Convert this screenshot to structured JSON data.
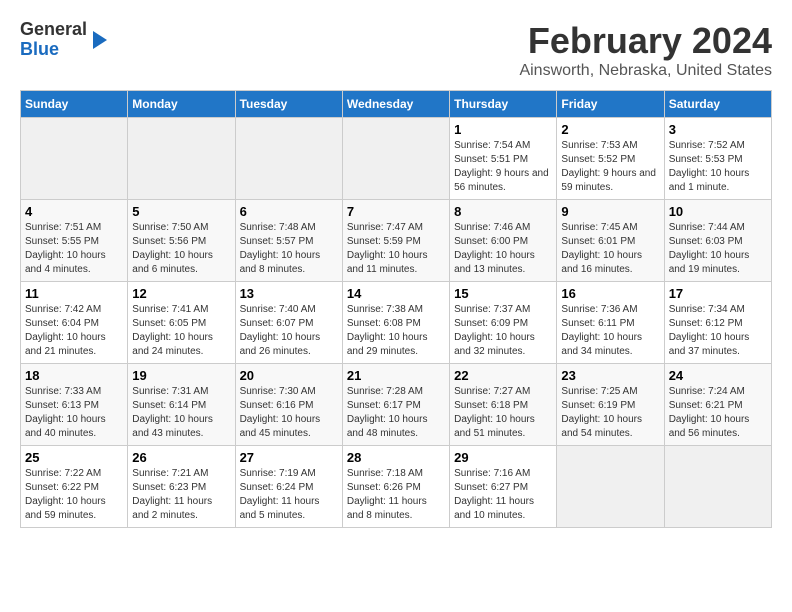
{
  "header": {
    "logo_line1": "General",
    "logo_line2": "Blue",
    "month": "February 2024",
    "location": "Ainsworth, Nebraska, United States"
  },
  "weekdays": [
    "Sunday",
    "Monday",
    "Tuesday",
    "Wednesday",
    "Thursday",
    "Friday",
    "Saturday"
  ],
  "weeks": [
    [
      {
        "day": "",
        "info": ""
      },
      {
        "day": "",
        "info": ""
      },
      {
        "day": "",
        "info": ""
      },
      {
        "day": "",
        "info": ""
      },
      {
        "day": "1",
        "info": "Sunrise: 7:54 AM\nSunset: 5:51 PM\nDaylight: 9 hours and 56 minutes."
      },
      {
        "day": "2",
        "info": "Sunrise: 7:53 AM\nSunset: 5:52 PM\nDaylight: 9 hours and 59 minutes."
      },
      {
        "day": "3",
        "info": "Sunrise: 7:52 AM\nSunset: 5:53 PM\nDaylight: 10 hours and 1 minute."
      }
    ],
    [
      {
        "day": "4",
        "info": "Sunrise: 7:51 AM\nSunset: 5:55 PM\nDaylight: 10 hours and 4 minutes."
      },
      {
        "day": "5",
        "info": "Sunrise: 7:50 AM\nSunset: 5:56 PM\nDaylight: 10 hours and 6 minutes."
      },
      {
        "day": "6",
        "info": "Sunrise: 7:48 AM\nSunset: 5:57 PM\nDaylight: 10 hours and 8 minutes."
      },
      {
        "day": "7",
        "info": "Sunrise: 7:47 AM\nSunset: 5:59 PM\nDaylight: 10 hours and 11 minutes."
      },
      {
        "day": "8",
        "info": "Sunrise: 7:46 AM\nSunset: 6:00 PM\nDaylight: 10 hours and 13 minutes."
      },
      {
        "day": "9",
        "info": "Sunrise: 7:45 AM\nSunset: 6:01 PM\nDaylight: 10 hours and 16 minutes."
      },
      {
        "day": "10",
        "info": "Sunrise: 7:44 AM\nSunset: 6:03 PM\nDaylight: 10 hours and 19 minutes."
      }
    ],
    [
      {
        "day": "11",
        "info": "Sunrise: 7:42 AM\nSunset: 6:04 PM\nDaylight: 10 hours and 21 minutes."
      },
      {
        "day": "12",
        "info": "Sunrise: 7:41 AM\nSunset: 6:05 PM\nDaylight: 10 hours and 24 minutes."
      },
      {
        "day": "13",
        "info": "Sunrise: 7:40 AM\nSunset: 6:07 PM\nDaylight: 10 hours and 26 minutes."
      },
      {
        "day": "14",
        "info": "Sunrise: 7:38 AM\nSunset: 6:08 PM\nDaylight: 10 hours and 29 minutes."
      },
      {
        "day": "15",
        "info": "Sunrise: 7:37 AM\nSunset: 6:09 PM\nDaylight: 10 hours and 32 minutes."
      },
      {
        "day": "16",
        "info": "Sunrise: 7:36 AM\nSunset: 6:11 PM\nDaylight: 10 hours and 34 minutes."
      },
      {
        "day": "17",
        "info": "Sunrise: 7:34 AM\nSunset: 6:12 PM\nDaylight: 10 hours and 37 minutes."
      }
    ],
    [
      {
        "day": "18",
        "info": "Sunrise: 7:33 AM\nSunset: 6:13 PM\nDaylight: 10 hours and 40 minutes."
      },
      {
        "day": "19",
        "info": "Sunrise: 7:31 AM\nSunset: 6:14 PM\nDaylight: 10 hours and 43 minutes."
      },
      {
        "day": "20",
        "info": "Sunrise: 7:30 AM\nSunset: 6:16 PM\nDaylight: 10 hours and 45 minutes."
      },
      {
        "day": "21",
        "info": "Sunrise: 7:28 AM\nSunset: 6:17 PM\nDaylight: 10 hours and 48 minutes."
      },
      {
        "day": "22",
        "info": "Sunrise: 7:27 AM\nSunset: 6:18 PM\nDaylight: 10 hours and 51 minutes."
      },
      {
        "day": "23",
        "info": "Sunrise: 7:25 AM\nSunset: 6:19 PM\nDaylight: 10 hours and 54 minutes."
      },
      {
        "day": "24",
        "info": "Sunrise: 7:24 AM\nSunset: 6:21 PM\nDaylight: 10 hours and 56 minutes."
      }
    ],
    [
      {
        "day": "25",
        "info": "Sunrise: 7:22 AM\nSunset: 6:22 PM\nDaylight: 10 hours and 59 minutes."
      },
      {
        "day": "26",
        "info": "Sunrise: 7:21 AM\nSunset: 6:23 PM\nDaylight: 11 hours and 2 minutes."
      },
      {
        "day": "27",
        "info": "Sunrise: 7:19 AM\nSunset: 6:24 PM\nDaylight: 11 hours and 5 minutes."
      },
      {
        "day": "28",
        "info": "Sunrise: 7:18 AM\nSunset: 6:26 PM\nDaylight: 11 hours and 8 minutes."
      },
      {
        "day": "29",
        "info": "Sunrise: 7:16 AM\nSunset: 6:27 PM\nDaylight: 11 hours and 10 minutes."
      },
      {
        "day": "",
        "info": ""
      },
      {
        "day": "",
        "info": ""
      }
    ]
  ]
}
